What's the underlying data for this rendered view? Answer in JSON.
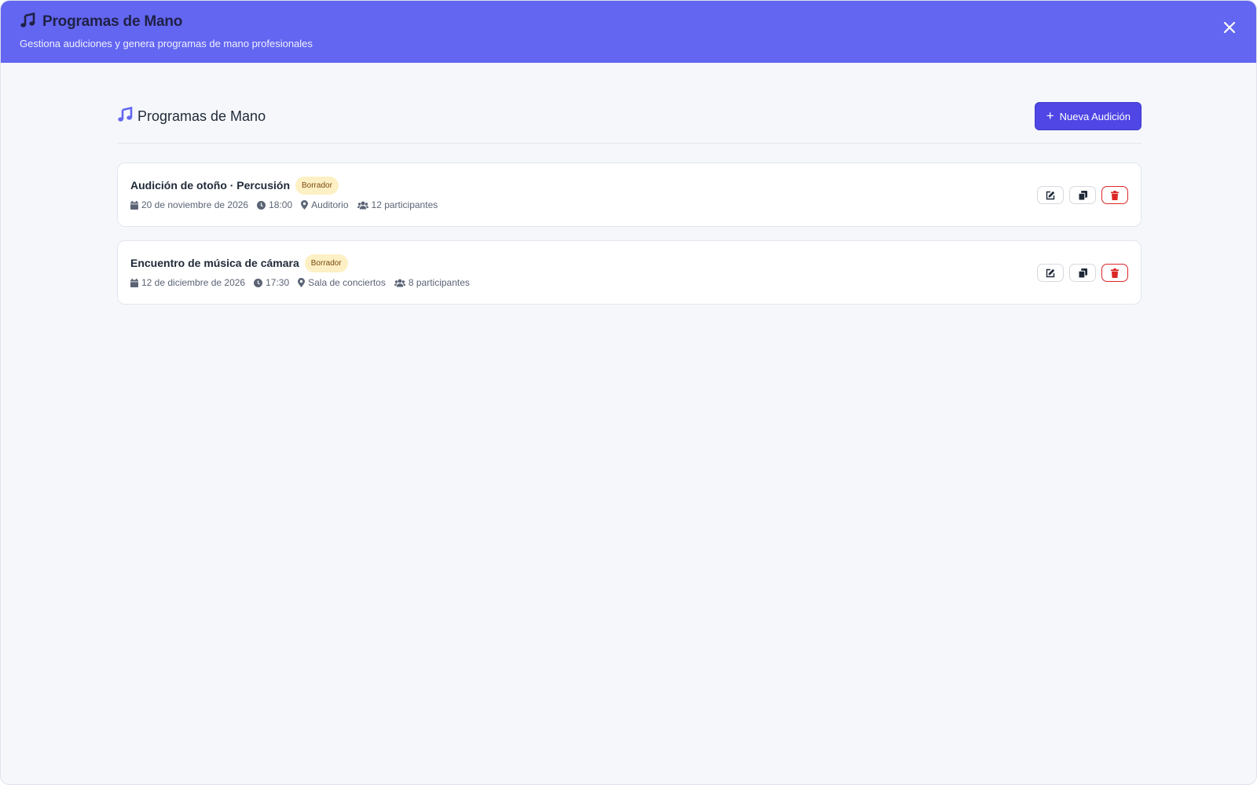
{
  "header": {
    "title": "Programas de Mano",
    "subtitle": "Gestiona audiciones y genera programas de mano profesionales",
    "close_icon": "close-icon"
  },
  "main": {
    "title": "Programas de Mano",
    "new_button_label": "Nueva Audición",
    "items": [
      {
        "title": "Audición de otoño · Percusión",
        "status": "Borrador",
        "date": "20 de noviembre de 2026",
        "time": "18:00",
        "location": "Auditorio",
        "participants": "12 participantes"
      },
      {
        "title": "Encuentro de música de cámara",
        "status": "Borrador",
        "date": "12 de diciembre de 2026",
        "time": "17:30",
        "location": "Sala de conciertos",
        "participants": "8 participantes"
      }
    ]
  },
  "colors": {
    "header_bg": "#6366f1",
    "primary": "#4f46e5",
    "danger": "#dc2626",
    "badge_bg": "#fdf0c4"
  },
  "icons": [
    "music-icon",
    "plus-icon",
    "calendar-icon",
    "clock-icon",
    "map-pin-icon",
    "users-icon",
    "edit-icon",
    "copy-icon",
    "trash-icon",
    "close-icon"
  ]
}
